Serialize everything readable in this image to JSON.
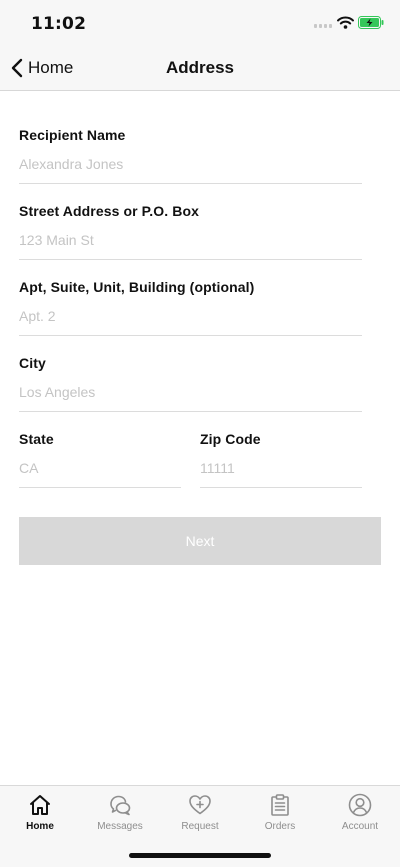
{
  "status": {
    "time": "11:02"
  },
  "nav": {
    "back_label": "Home",
    "title": "Address"
  },
  "form": {
    "recipient": {
      "label": "Recipient Name",
      "placeholder": "Alexandra Jones"
    },
    "street": {
      "label": "Street Address or P.O. Box",
      "placeholder": "123 Main St"
    },
    "apt": {
      "label": "Apt, Suite, Unit, Building (optional)",
      "placeholder": "Apt. 2"
    },
    "city": {
      "label": "City",
      "placeholder": "Los Angeles"
    },
    "state": {
      "label": "State",
      "placeholder": "CA"
    },
    "zip": {
      "label": "Zip Code",
      "placeholder": "11111"
    },
    "next_label": "Next"
  },
  "tabs": [
    {
      "label": "Home",
      "icon": "home-icon",
      "active": true
    },
    {
      "label": "Messages",
      "icon": "messages-icon",
      "active": false
    },
    {
      "label": "Request",
      "icon": "heart-plus-icon",
      "active": false
    },
    {
      "label": "Orders",
      "icon": "clipboard-icon",
      "active": false
    },
    {
      "label": "Account",
      "icon": "account-icon",
      "active": false
    }
  ],
  "colors": {
    "battery_fill": "#34c759",
    "button_disabled": "#d8d8d8",
    "placeholder": "#c4c4c4",
    "tab_inactive": "#8e8e8e"
  }
}
